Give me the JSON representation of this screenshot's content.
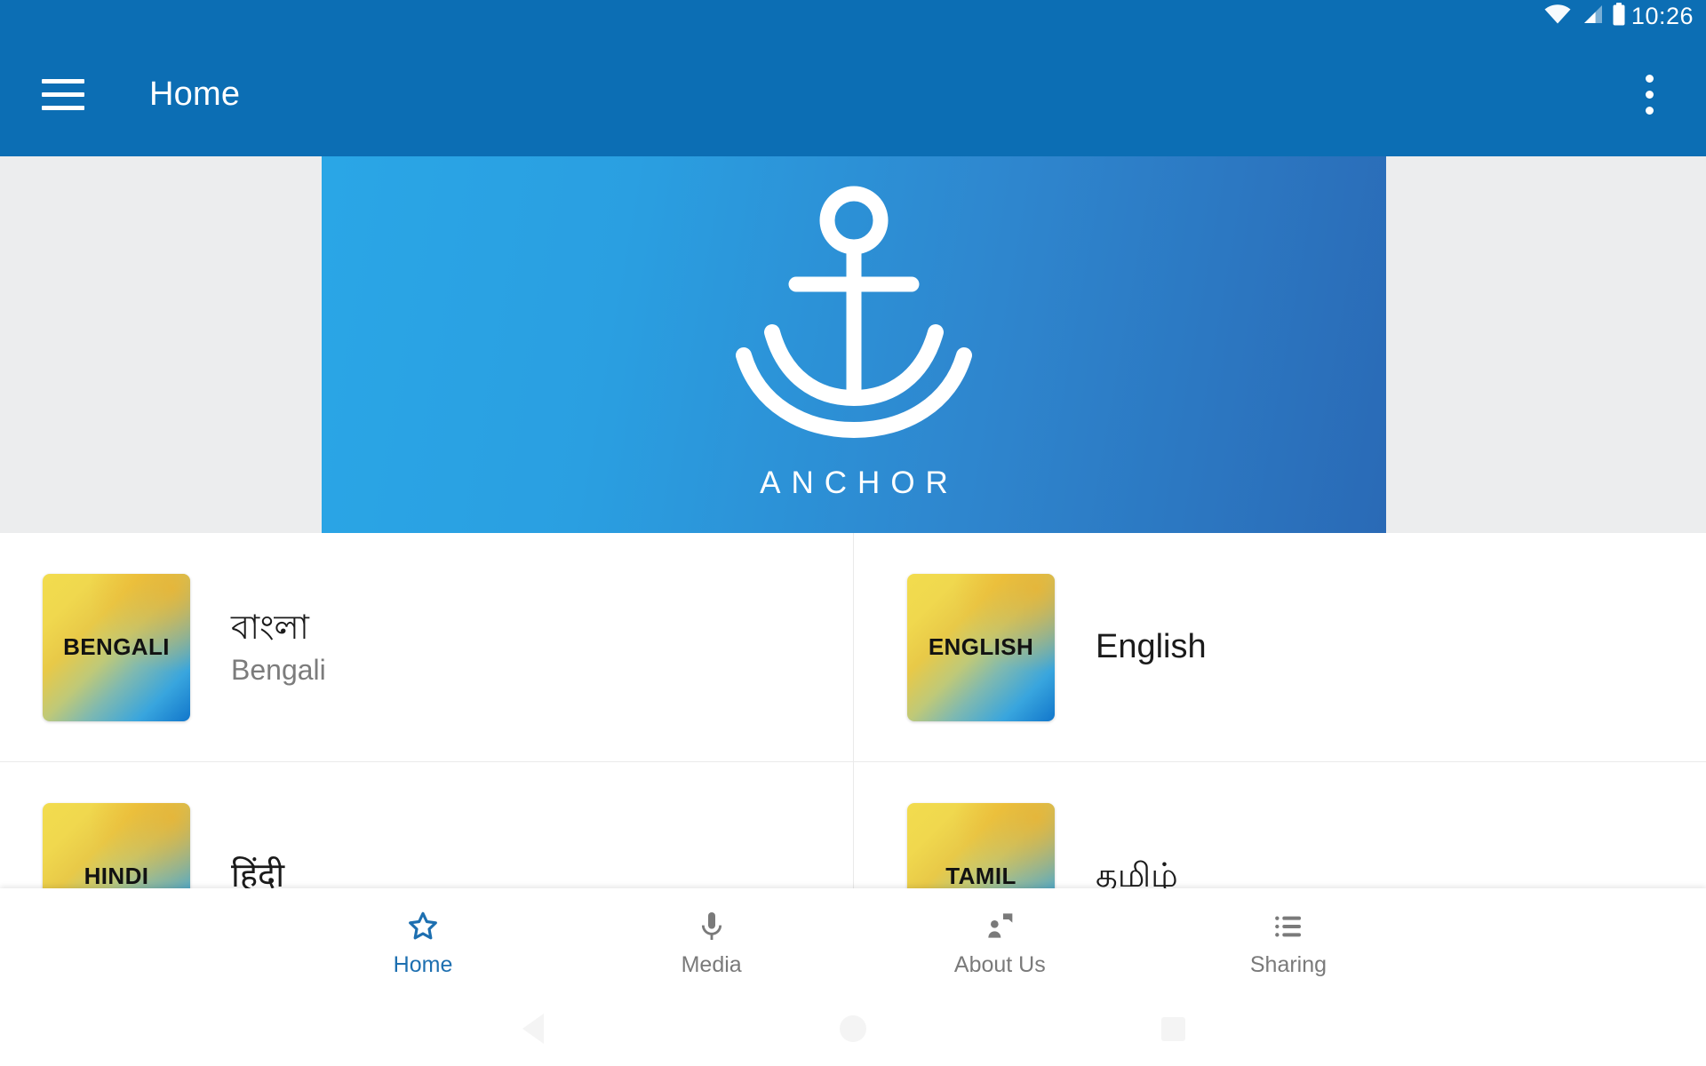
{
  "status_bar": {
    "time": "10:26",
    "icons": [
      "wifi-icon",
      "cellular-signal-icon",
      "battery-icon"
    ]
  },
  "app_bar": {
    "menu_icon": "hamburger-menu-icon",
    "title": "Home",
    "overflow_icon": "overflow-menu-icon",
    "background_color": "#0C6EB4"
  },
  "banner": {
    "logo_icon": "anchor-logo-icon",
    "wordmark": "ANCHOR",
    "gradient_from": "#2AA6E6",
    "gradient_to": "#2A6AB6",
    "surround_color": "#ECEDEE"
  },
  "languages": [
    {
      "thumb_label": "BENGALI",
      "native": "বাংলা",
      "english": "Bengali"
    },
    {
      "thumb_label": "ENGLISH",
      "native": "English",
      "english": ""
    },
    {
      "thumb_label": "HINDI",
      "native": "हिंदी",
      "english": ""
    },
    {
      "thumb_label": "TAMIL",
      "native": "தமிழ்",
      "english": ""
    }
  ],
  "bottom_nav": {
    "active_color": "#1D6FB0",
    "inactive_color": "#7A7A7A",
    "items": [
      {
        "label": "Home",
        "icon": "star-outline-icon",
        "active": true
      },
      {
        "label": "Media",
        "icon": "microphone-icon",
        "active": false
      },
      {
        "label": "About Us",
        "icon": "person-speech-bubble-icon",
        "active": false
      },
      {
        "label": "Sharing",
        "icon": "list-icon",
        "active": false
      }
    ]
  },
  "system_nav": {
    "items": [
      {
        "icon": "android-back-icon"
      },
      {
        "icon": "android-home-icon"
      },
      {
        "icon": "android-recents-icon"
      }
    ]
  }
}
